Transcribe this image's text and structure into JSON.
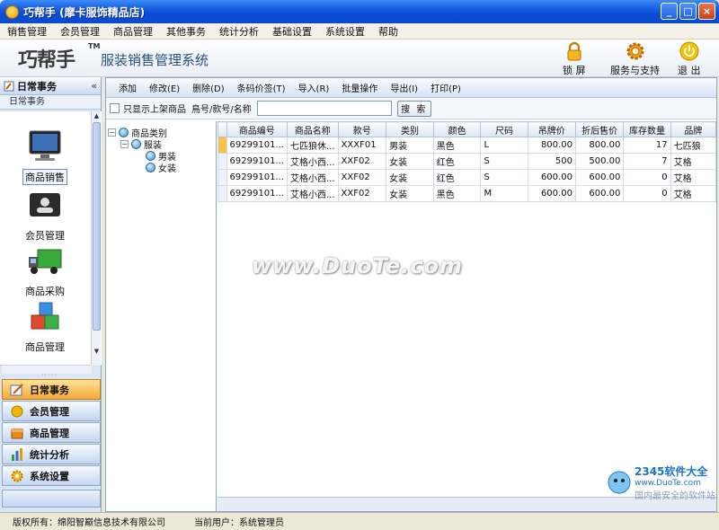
{
  "window": {
    "title": "巧帮手 (摩卡服饰精品店)"
  },
  "menu": [
    "销售管理",
    "会员管理",
    "商品管理",
    "其他事务",
    "统计分析",
    "基础设置",
    "系统设置",
    "帮助"
  ],
  "banner": {
    "logo": "巧帮手",
    "logo_tm": "TM",
    "system_name": "服装销售管理系统",
    "lock_label": "锁 屏",
    "service_label": "服务与支持",
    "exit_label": "退 出"
  },
  "left_panel": {
    "header": "日常事务",
    "subheader": "日常事务",
    "modules": [
      "商品销售",
      "会员管理",
      "商品采购",
      "商品管理"
    ],
    "nav": [
      "日常事务",
      "会员管理",
      "商品管理",
      "统计分析",
      "系统设置"
    ]
  },
  "toolbar": [
    "添加",
    "修改(E)",
    "删除(D)",
    "条码价签(T)",
    "导入(R)",
    "批量操作",
    "导出(I)",
    "打印(P)"
  ],
  "filter": {
    "checkbox_label": "只显示上架商品",
    "search_label": "鳥号/款号/名称",
    "search_value": "",
    "search_button": "搜 索"
  },
  "tree": {
    "root": "商品类别",
    "child": "服装",
    "leaves": [
      "男装",
      "女装"
    ]
  },
  "table": {
    "columns": [
      "商品编号",
      "商品名称",
      "款号",
      "类别",
      "颜色",
      "尺码",
      "吊牌价",
      "折后售价",
      "库存数量",
      "品牌"
    ],
    "rows": [
      [
        "69299101...",
        "七匹狼休...",
        "XXXF01",
        "男装",
        "黑色",
        "L",
        "800.00",
        "800.00",
        "17",
        "七匹狼"
      ],
      [
        "69299101...",
        "艾格小西...",
        "XXF02",
        "女装",
        "红色",
        "S",
        "500",
        "500.00",
        "7",
        "艾格"
      ],
      [
        "69299101...",
        "艾格小西...",
        "XXF02",
        "女装",
        "红色",
        "S",
        "600.00",
        "600.00",
        "0",
        "艾格"
      ],
      [
        "69299101...",
        "艾格小西...",
        "XXF02",
        "女装",
        "黑色",
        "M",
        "600.00",
        "600.00",
        "0",
        "艾格"
      ]
    ]
  },
  "watermark": "www.DuoTe.com",
  "site_logo": {
    "brand": "2345软件大全",
    "url": "www.DuoTe.com",
    "slogan": "国内最安全的软件站"
  },
  "status": {
    "copyright": "版权所有：绵阳智巅信息技术有限公司",
    "user": "当前用户：系统管理员"
  },
  "colors": {
    "title_bar": "#0b4dd6",
    "active_nav": "#f6a93a",
    "selected_row_marker": "#f7c24a"
  }
}
